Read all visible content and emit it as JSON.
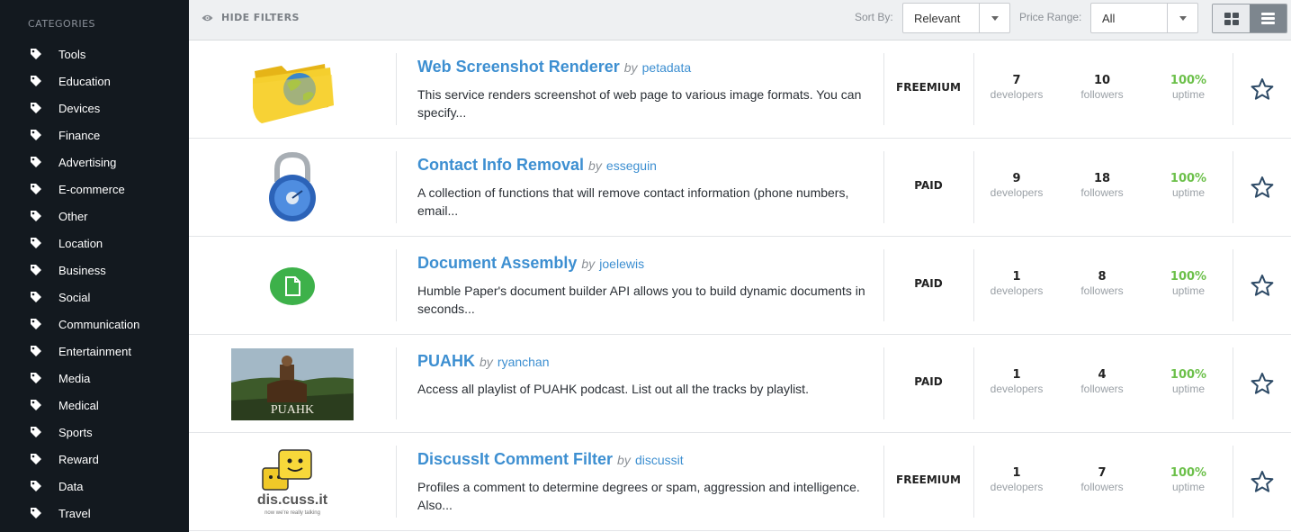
{
  "sidebar": {
    "heading": "CATEGORIES",
    "items": [
      {
        "label": "Tools"
      },
      {
        "label": "Education"
      },
      {
        "label": "Devices"
      },
      {
        "label": "Finance"
      },
      {
        "label": "Advertising"
      },
      {
        "label": "E-commerce"
      },
      {
        "label": "Other"
      },
      {
        "label": "Location"
      },
      {
        "label": "Business"
      },
      {
        "label": "Social"
      },
      {
        "label": "Communication"
      },
      {
        "label": "Entertainment"
      },
      {
        "label": "Media"
      },
      {
        "label": "Medical"
      },
      {
        "label": "Sports"
      },
      {
        "label": "Reward"
      },
      {
        "label": "Data"
      },
      {
        "label": "Travel"
      }
    ]
  },
  "topbar": {
    "hide_filters": "HIDE FILTERS",
    "sort_label": "Sort By:",
    "sort_value": "Relevant",
    "price_label": "Price Range:",
    "price_value": "All",
    "active_view": "list"
  },
  "apis": [
    {
      "title": "Web Screenshot Renderer",
      "by": "by",
      "author": "petadata",
      "description": "This service renders screenshot of web page to various image formats. You can specify...",
      "pricing": "FREEMIUM",
      "developers": "7",
      "developers_label": "developers",
      "followers": "10",
      "followers_label": "followers",
      "uptime": "100%",
      "uptime_label": "uptime",
      "icon": "folder-globe-icon"
    },
    {
      "title": "Contact Info Removal",
      "by": "by",
      "author": "esseguin",
      "description": "A collection of functions that will remove contact information (phone numbers, email...",
      "pricing": "PAID",
      "developers": "9",
      "developers_label": "developers",
      "followers": "18",
      "followers_label": "followers",
      "uptime": "100%",
      "uptime_label": "uptime",
      "icon": "padlock-icon"
    },
    {
      "title": "Document Assembly",
      "by": "by",
      "author": "joelewis",
      "description": "Humble Paper's document builder API allows you to build dynamic documents in seconds...",
      "pricing": "PAID",
      "developers": "1",
      "developers_label": "developers",
      "followers": "8",
      "followers_label": "followers",
      "uptime": "100%",
      "uptime_label": "uptime",
      "icon": "document-icon"
    },
    {
      "title": "PUAHK",
      "by": "by",
      "author": "ryanchan",
      "description": "Access all playlist of PUAHK podcast. List out all the tracks by playlist.",
      "pricing": "PAID",
      "developers": "1",
      "developers_label": "developers",
      "followers": "4",
      "followers_label": "followers",
      "uptime": "100%",
      "uptime_label": "uptime",
      "icon": "puahk-photo",
      "thumb_text": "PUAHK"
    },
    {
      "title": "DiscussIt Comment Filter",
      "by": "by",
      "author": "discussit",
      "description": "Profiles a comment to determine degrees or spam, aggression and intelligence. Also...",
      "pricing": "FREEMIUM",
      "developers": "1",
      "developers_label": "developers",
      "followers": "7",
      "followers_label": "followers",
      "uptime": "100%",
      "uptime_label": "uptime",
      "icon": "discussit-logo",
      "thumb_text": "dis.cuss.it",
      "thumb_subtext": "now we're really talking"
    }
  ],
  "colors": {
    "sidebar_bg": "#13191f",
    "link": "#3d8fd1",
    "uptime": "#6cc04a",
    "topbar_bg": "#eef0f2"
  }
}
